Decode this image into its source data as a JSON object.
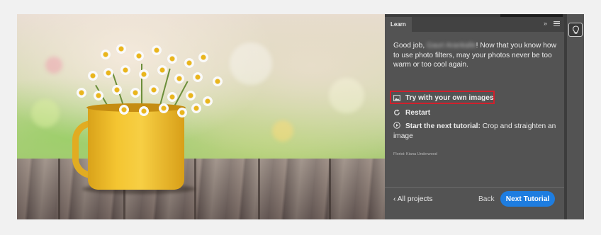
{
  "panel": {
    "tab_label": "Learn",
    "expand_icon": "double-chevron-right-icon",
    "menu_icon": "hamburger-menu-icon",
    "message_prefix": "Good job, ",
    "user_name": "Gauri Arankalle",
    "message_suffix": "! Now that you know how to use photo filters, may your photos never be too warm or too cool again.",
    "actions": {
      "try_label": "Try with your own images",
      "restart_label": "Restart",
      "next_label": "Start the next tutorial:",
      "next_tutorial_title": "Crop and straighten an image"
    },
    "credit": "Florist: Kiana Underwood",
    "footer": {
      "all_projects_label": "All projects",
      "back_label": "Back",
      "next_tutorial_label": "Next Tutorial"
    }
  },
  "right_toolbar": {
    "icon": "lightbulb-icon"
  },
  "colors": {
    "panel_bg": "#535353",
    "accent": "#1e7de0",
    "highlight": "#d0202c"
  }
}
